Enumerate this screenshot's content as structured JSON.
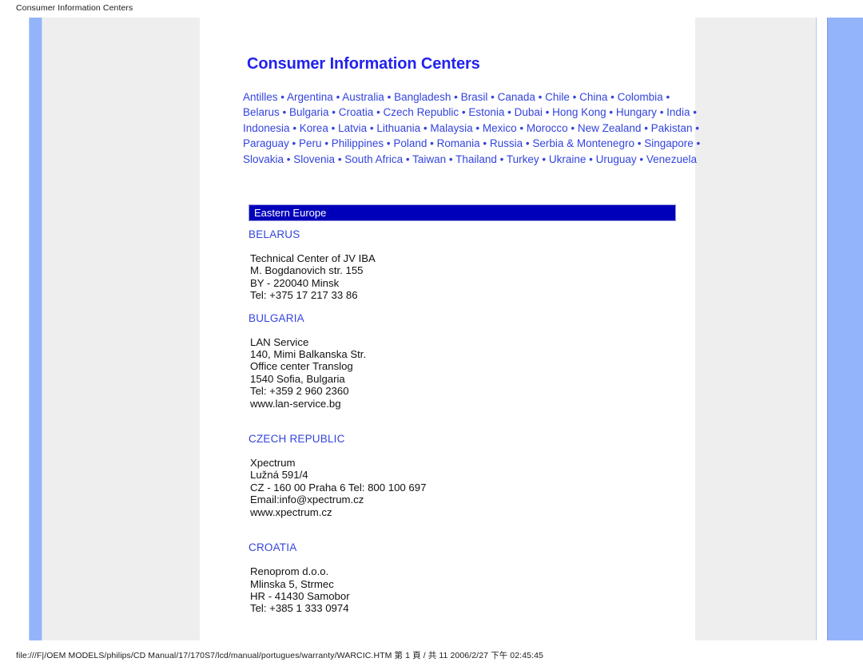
{
  "print": {
    "header": "Consumer Information Centers",
    "footer": "file:///F|/OEM MODELS/philips/CD Manual/17/170S7/lcd/manual/portugues/warranty/WARCIC.HTM 第 1 頁 / 共 11 2006/2/27 下午 02:45:45"
  },
  "colors": {
    "link": "#3344dd",
    "title": "#2222ee",
    "banner_bg": "#0000bb",
    "banner_border": "#9999dd",
    "panel_gray": "#eeeeee",
    "stripe_blue": "#93b4fb"
  },
  "document": {
    "title": "Consumer Information Centers",
    "country_links": [
      "Antilles",
      "Argentina",
      "Australia",
      "Bangladesh",
      "Brasil",
      "Canada",
      "Chile",
      "China",
      "Colombia",
      "Belarus",
      "Bulgaria",
      "Croatia",
      "Czech Republic",
      "Estonia",
      "Dubai",
      "Hong Kong",
      "Hungary",
      "India",
      "Indonesia",
      "Korea",
      "Latvia",
      "Lithuania",
      "Malaysia",
      "Mexico",
      "Morocco",
      "New Zealand",
      "Pakistan",
      "Paraguay",
      "Peru",
      "Philippines",
      "Poland",
      "Romania",
      "Russia",
      "Serbia & Montenegro",
      "Singapore",
      "Slovakia",
      "Slovenia",
      "South Africa",
      "Taiwan",
      "Thailand",
      "Turkey",
      "Ukraine",
      "Uruguay",
      "Venezuela"
    ],
    "country_links_separator": "•",
    "section_banner": "Eastern Europe",
    "entries": [
      {
        "country": "BELARUS",
        "lines": [
          "Technical Center of JV IBA",
          "M. Bogdanovich str. 155",
          "BY - 220040 Minsk",
          "Tel: +375 17 217 33 86"
        ]
      },
      {
        "country": "BULGARIA",
        "lines": [
          "LAN Service",
          "140, Mimi Balkanska Str.",
          "Office center Translog",
          "1540 Sofia, Bulgaria",
          "Tel: +359 2 960 2360",
          "www.lan-service.bg"
        ]
      },
      {
        "country": "CZECH REPUBLIC",
        "lines": [
          "Xpectrum",
          "Lužná 591/4",
          "CZ - 160 00 Praha 6 Tel: 800 100 697",
          "Email:info@xpectrum.cz",
          "www.xpectrum.cz"
        ]
      },
      {
        "country": "CROATIA",
        "lines": [
          "Renoprom d.o.o.",
          "Mlinska 5, Strmec",
          "HR - 41430 Samobor",
          "Tel: +385 1 333 0974"
        ]
      }
    ]
  }
}
